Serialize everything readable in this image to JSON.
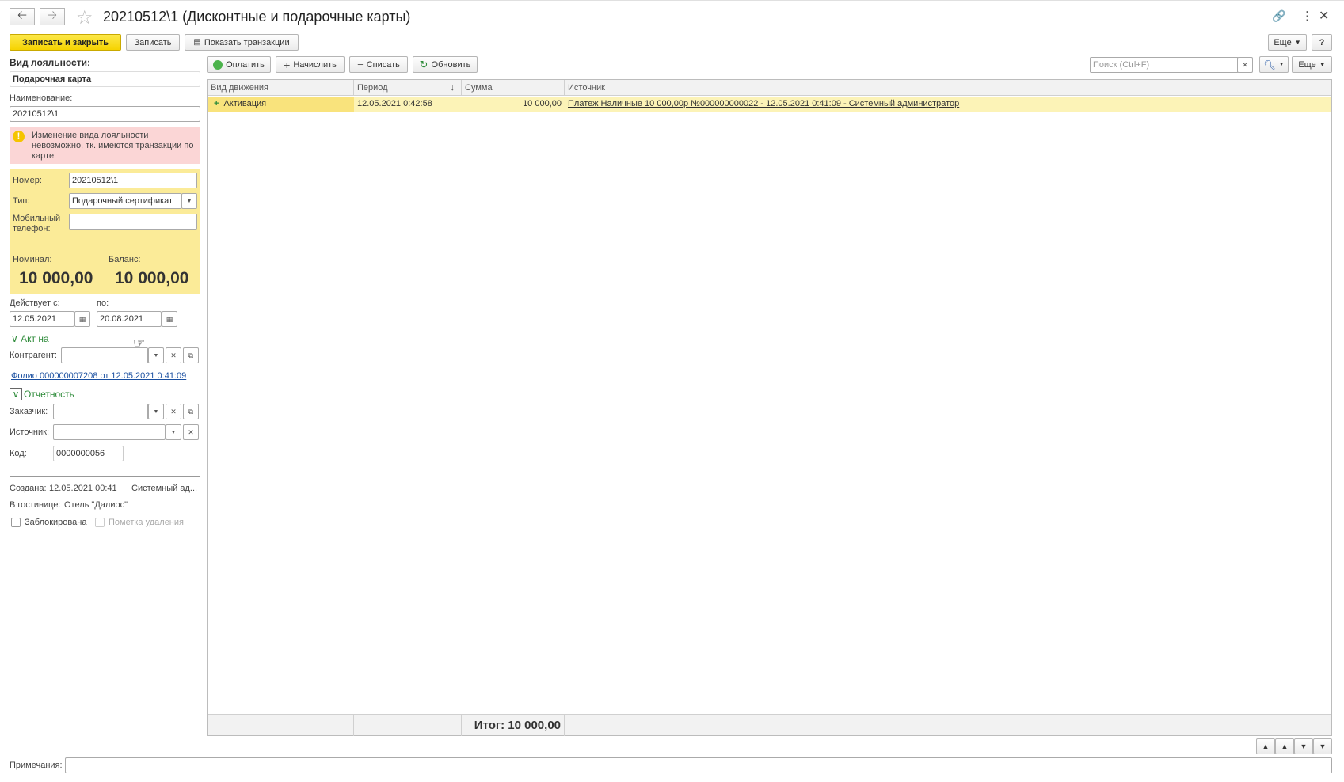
{
  "window": {
    "title": "20210512\\1 (Дисконтные и подарочные карты)"
  },
  "toolbar": {
    "save_close": "Записать и закрыть",
    "save": "Записать",
    "show_transactions": "Показать транзакции",
    "more": "Еще",
    "help": "?"
  },
  "form": {
    "loyalty_label": "Вид лояльности:",
    "loyalty_value": "Подарочная карта",
    "name_label": "Наименование:",
    "name_value": "20210512\\1",
    "alert_text": "Изменение вида лояльности невозможно, тк. имеются транзакции по карте",
    "number_label": "Номер:",
    "number_value": "20210512\\1",
    "type_label": "Тип:",
    "type_value": "Подарочный сертификат",
    "phone_label": "Мобильный телефон:",
    "phone_value": "",
    "nominal_label": "Номинал:",
    "nominal_value": "10 000,00",
    "balance_label": "Баланс:",
    "balance_value": "10 000,00",
    "valid_from_label": "Действует с:",
    "valid_from_value": "12.05.2021",
    "valid_to_label": "по:",
    "valid_to_value": "20.08.2021",
    "akt_group": "Акт на",
    "counterparty_label": "Контрагент:",
    "counterparty_value": "",
    "folio_link": "Фолио 000000007208 от 12.05.2021 0:41:09",
    "reporting_group": "Отчетность",
    "customer_label": "Заказчик:",
    "customer_value": "",
    "source_label": "Источник:",
    "source_value": "",
    "code_label": "Код:",
    "code_value": "0000000056",
    "created_label": "Создана:",
    "created_value": "12.05.2021 00:41",
    "created_by": "Системный ад...",
    "hotel_label": "В гостинице:",
    "hotel_value": "Отель \"Далиос\"",
    "blocked_label": "Заблокирована",
    "deletion_label": "Пометка удаления",
    "notes_label": "Примечания:",
    "notes_value": ""
  },
  "table_toolbar": {
    "pay": "Оплатить",
    "accrue": "Начислить",
    "writeoff": "Списать",
    "refresh": "Обновить",
    "search_placeholder": "Поиск (Ctrl+F)",
    "more": "Еще"
  },
  "table": {
    "columns": [
      "Вид движения",
      "Период",
      "Сумма",
      "Источник"
    ],
    "rows": [
      {
        "kind": "Активация",
        "period": "12.05.2021 0:42:58",
        "sum": "10 000,00",
        "source": "Платеж Наличные 10 000,00р №000000000022 - 12.05.2021 0:41:09 - Системный администратор"
      }
    ],
    "total": "Итог: 10 000,00"
  },
  "icons": {
    "back": "arrow-left",
    "forward": "arrow-right",
    "favorite": "star",
    "link": "link",
    "menu": "kebab",
    "close": "close",
    "calendar": "calendar",
    "search": "magnifier"
  },
  "colors": {
    "primary_button": "#f6d300",
    "highlight_row": "#fcf3b7",
    "card_panel": "#fbeb98",
    "alert_panel": "#fbd6d6",
    "group_green": "#2e8b3a"
  }
}
